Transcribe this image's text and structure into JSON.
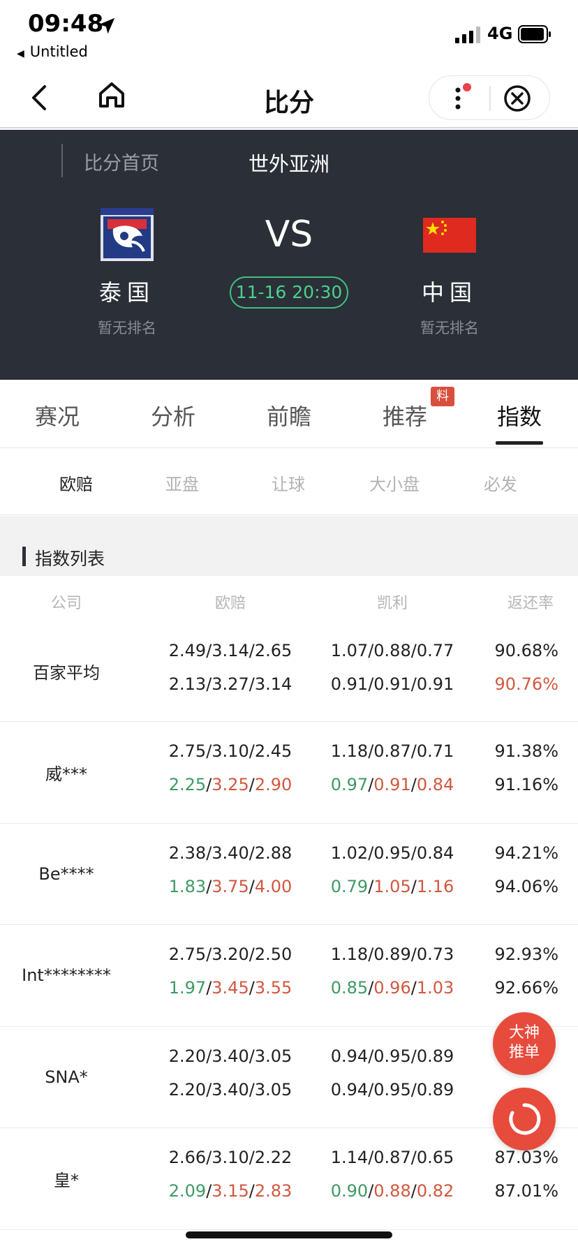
{
  "status_bar": {
    "time": "09:48",
    "back_app": "Untitled",
    "network": "4G"
  },
  "nav": {
    "title": "比分"
  },
  "match": {
    "crumb": "比分首页",
    "league": "世外亚洲",
    "vs": "VS",
    "kickoff": "11-16 20:30",
    "home": {
      "name": "泰国",
      "rank": "暂无排名"
    },
    "away": {
      "name": "中国",
      "rank": "暂无排名"
    }
  },
  "tabs": [
    {
      "label": "赛况"
    },
    {
      "label": "分析"
    },
    {
      "label": "前瞻"
    },
    {
      "label": "推荐",
      "badge": "料"
    },
    {
      "label": "指数",
      "active": true
    }
  ],
  "subtabs": [
    {
      "label": "欧赔",
      "active": true
    },
    {
      "label": "亚盘"
    },
    {
      "label": "让球"
    },
    {
      "label": "大小盘"
    },
    {
      "label": "必发"
    }
  ],
  "section": {
    "label": "指数列表"
  },
  "table": {
    "headers": [
      "公司",
      "欧赔",
      "凯利",
      "返还率"
    ],
    "rows": [
      {
        "company": "百家平均",
        "eu_open": [
          {
            "v": "2.49",
            "c": "same"
          },
          {
            "v": "3.14",
            "c": "same"
          },
          {
            "v": "2.65",
            "c": "same"
          }
        ],
        "eu_now": [
          {
            "v": "2.13",
            "c": "same"
          },
          {
            "v": "3.27",
            "c": "same"
          },
          {
            "v": "3.14",
            "c": "same"
          }
        ],
        "kl_open": [
          {
            "v": "1.07",
            "c": "same"
          },
          {
            "v": "0.88",
            "c": "same"
          },
          {
            "v": "0.77",
            "c": "same"
          }
        ],
        "kl_now": [
          {
            "v": "0.91",
            "c": "same"
          },
          {
            "v": "0.91",
            "c": "same"
          },
          {
            "v": "0.91",
            "c": "same"
          }
        ],
        "rt_open": {
          "v": "90.68%",
          "c": "same"
        },
        "rt_now": {
          "v": "90.76%",
          "c": "up"
        }
      },
      {
        "company": "威***",
        "eu_open": [
          {
            "v": "2.75",
            "c": "same"
          },
          {
            "v": "3.10",
            "c": "same"
          },
          {
            "v": "2.45",
            "c": "same"
          }
        ],
        "eu_now": [
          {
            "v": "2.25",
            "c": "down"
          },
          {
            "v": "3.25",
            "c": "up"
          },
          {
            "v": "2.90",
            "c": "up"
          }
        ],
        "kl_open": [
          {
            "v": "1.18",
            "c": "same"
          },
          {
            "v": "0.87",
            "c": "same"
          },
          {
            "v": "0.71",
            "c": "same"
          }
        ],
        "kl_now": [
          {
            "v": "0.97",
            "c": "down"
          },
          {
            "v": "0.91",
            "c": "up"
          },
          {
            "v": "0.84",
            "c": "up"
          }
        ],
        "rt_open": {
          "v": "91.38%",
          "c": "same"
        },
        "rt_now": {
          "v": "91.16%",
          "c": "same"
        }
      },
      {
        "company": "Be****",
        "eu_open": [
          {
            "v": "2.38",
            "c": "same"
          },
          {
            "v": "3.40",
            "c": "same"
          },
          {
            "v": "2.88",
            "c": "same"
          }
        ],
        "eu_now": [
          {
            "v": "1.83",
            "c": "down"
          },
          {
            "v": "3.75",
            "c": "up"
          },
          {
            "v": "4.00",
            "c": "up"
          }
        ],
        "kl_open": [
          {
            "v": "1.02",
            "c": "same"
          },
          {
            "v": "0.95",
            "c": "same"
          },
          {
            "v": "0.84",
            "c": "same"
          }
        ],
        "kl_now": [
          {
            "v": "0.79",
            "c": "down"
          },
          {
            "v": "1.05",
            "c": "up"
          },
          {
            "v": "1.16",
            "c": "up"
          }
        ],
        "rt_open": {
          "v": "94.21%",
          "c": "same"
        },
        "rt_now": {
          "v": "94.06%",
          "c": "same"
        }
      },
      {
        "company": "Int********",
        "eu_open": [
          {
            "v": "2.75",
            "c": "same"
          },
          {
            "v": "3.20",
            "c": "same"
          },
          {
            "v": "2.50",
            "c": "same"
          }
        ],
        "eu_now": [
          {
            "v": "1.97",
            "c": "down"
          },
          {
            "v": "3.45",
            "c": "up"
          },
          {
            "v": "3.55",
            "c": "up"
          }
        ],
        "kl_open": [
          {
            "v": "1.18",
            "c": "same"
          },
          {
            "v": "0.89",
            "c": "same"
          },
          {
            "v": "0.73",
            "c": "same"
          }
        ],
        "kl_now": [
          {
            "v": "0.85",
            "c": "down"
          },
          {
            "v": "0.96",
            "c": "up"
          },
          {
            "v": "1.03",
            "c": "up"
          }
        ],
        "rt_open": {
          "v": "92.93%",
          "c": "same"
        },
        "rt_now": {
          "v": "92.66%",
          "c": "same"
        }
      },
      {
        "company": "SNA*",
        "eu_open": [
          {
            "v": "2.20",
            "c": "same"
          },
          {
            "v": "3.40",
            "c": "same"
          },
          {
            "v": "3.05",
            "c": "same"
          }
        ],
        "eu_now": [
          {
            "v": "2.20",
            "c": "same"
          },
          {
            "v": "3.40",
            "c": "same"
          },
          {
            "v": "3.05",
            "c": "same"
          }
        ],
        "kl_open": [
          {
            "v": "0.94",
            "c": "same"
          },
          {
            "v": "0.95",
            "c": "same"
          },
          {
            "v": "0.89",
            "c": "same"
          }
        ],
        "kl_now": [
          {
            "v": "0.94",
            "c": "same"
          },
          {
            "v": "0.95",
            "c": "same"
          },
          {
            "v": "0.89",
            "c": "same"
          }
        ],
        "rt_open": {
          "v": "",
          "c": "same"
        },
        "rt_now": {
          "v": "",
          "c": "same"
        }
      },
      {
        "company": "皇*",
        "eu_open": [
          {
            "v": "2.66",
            "c": "same"
          },
          {
            "v": "3.10",
            "c": "same"
          },
          {
            "v": "2.22",
            "c": "same"
          }
        ],
        "eu_now": [
          {
            "v": "2.09",
            "c": "down"
          },
          {
            "v": "3.15",
            "c": "up"
          },
          {
            "v": "2.83",
            "c": "up"
          }
        ],
        "kl_open": [
          {
            "v": "1.14",
            "c": "same"
          },
          {
            "v": "0.87",
            "c": "same"
          },
          {
            "v": "0.65",
            "c": "same"
          }
        ],
        "kl_now": [
          {
            "v": "0.90",
            "c": "down"
          },
          {
            "v": "0.88",
            "c": "up"
          },
          {
            "v": "0.82",
            "c": "up"
          }
        ],
        "rt_open": {
          "v": "87.03%",
          "c": "same"
        },
        "rt_now": {
          "v": "87.01%",
          "c": "same"
        }
      }
    ]
  },
  "fab": {
    "label_line1": "大神",
    "label_line2": "推单"
  },
  "colors": {
    "up": "#d1583f",
    "down": "#3e9a63",
    "header_bg": "#2b2f37",
    "accent_green": "#4cd08e",
    "fab": "#e74b3c"
  }
}
